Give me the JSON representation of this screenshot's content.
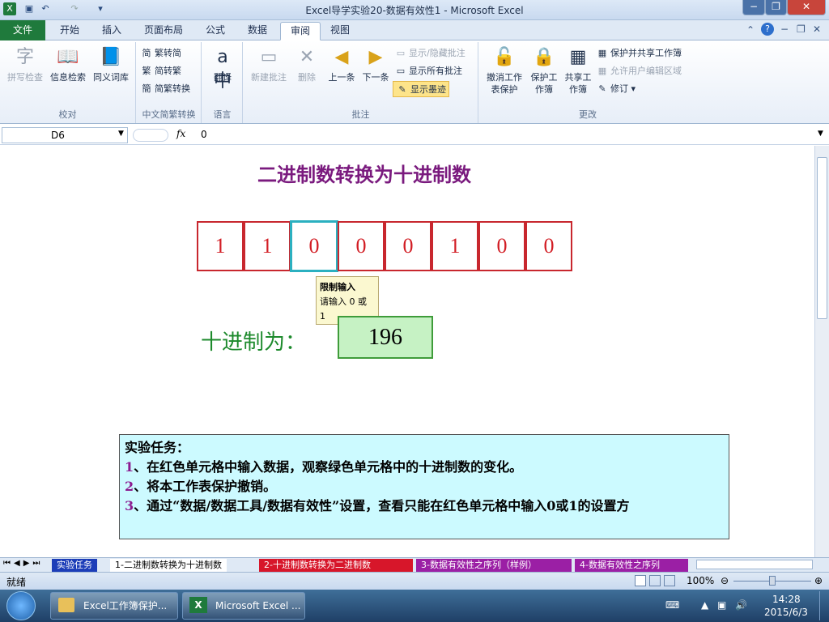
{
  "window": {
    "title": "Excel导学实验20-数据有效性1  -  Microsoft Excel"
  },
  "tabs": {
    "file": "文件",
    "items": [
      "开始",
      "插入",
      "页面布局",
      "公式",
      "数据",
      "审阅",
      "视图"
    ]
  },
  "ribbon": {
    "proofing": {
      "spell": "拼写检查",
      "research": "信息检索",
      "thesaurus": "同义词库",
      "label": "校对"
    },
    "chinese": {
      "t2s": "繁转简",
      "s2t": "简转繁",
      "convert": "简繁转换",
      "label": "中文简繁转换"
    },
    "language": {
      "translate": "翻译",
      "label": "语言"
    },
    "comments": {
      "new": "新建批注",
      "delete": "删除",
      "prev": "上一条",
      "next": "下一条",
      "showhide": "显示/隐藏批注",
      "showall": "显示所有批注",
      "showink": "显示墨迹",
      "label": "批注"
    },
    "changes": {
      "unprotect": "撤消工作表保护",
      "protect": "保护工作簿",
      "share": "共享工作簿",
      "protectshare": "保护并共享工作簿",
      "allowedit": "允许用户编辑区域",
      "track": "修订",
      "label": "更改"
    }
  },
  "formula": {
    "cell": "D6",
    "fx": "fx",
    "value": "0"
  },
  "sheet": {
    "heading": "二进制数转换为十进制数",
    "bits": [
      "1",
      "1",
      "0",
      "0",
      "0",
      "1",
      "0",
      "0"
    ],
    "tooltip": {
      "title": "限制输入",
      "line1": "请输入 0 或",
      "line2": "1"
    },
    "dec_label": "十进制为：",
    "dec_value": "196",
    "task": {
      "title": "实验任务：",
      "items": [
        {
          "n": "1",
          "text": "、在红色单元格中输入数据，观察绿色单元格中的十进制数的变化。"
        },
        {
          "n": "2",
          "text": "、将本工作表保护撤销。"
        },
        {
          "n": "3",
          "text": "、通过“数据/数据工具/数据有效性”设置，查看只能在红色单元格中输入0或1的设置方"
        }
      ]
    }
  },
  "sheettabs": [
    "实验任务",
    "1-二进制数转换为十进制数",
    "2-十进制数转换为二进制数",
    "3-数据有效性之序列（样例）",
    "4-数据有效性之序列"
  ],
  "status": {
    "ready": "就绪",
    "zoom": "100%"
  },
  "taskbar": {
    "items": [
      "Excel工作簿保护...",
      "Microsoft Excel ..."
    ],
    "time": "14:28",
    "date": "2015/6/3"
  }
}
